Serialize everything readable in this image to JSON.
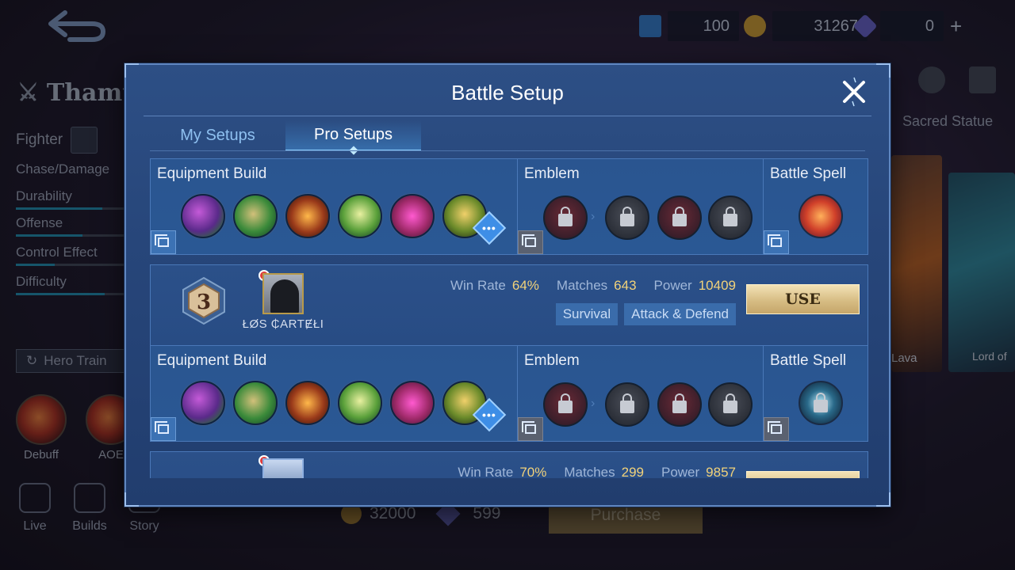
{
  "background": {
    "hero_name": "Thamu",
    "role": "Fighter",
    "stats": [
      {
        "label": "Chase/Damage",
        "value": 0.0
      },
      {
        "label": "Durability",
        "value": 0.78
      },
      {
        "label": "Offense",
        "value": 0.6
      },
      {
        "label": "Control Effect",
        "value": 0.35
      },
      {
        "label": "Difficulty",
        "value": 0.8
      }
    ],
    "hero_train_label": "Hero Train",
    "skills": [
      {
        "label": "Debuff"
      },
      {
        "label": "AOE"
      }
    ],
    "nav": [
      {
        "label": "Live"
      },
      {
        "label": "Builds"
      },
      {
        "label": "Story"
      }
    ],
    "resources": {
      "tickets": "100",
      "gold": "31267",
      "diamonds": "0"
    },
    "price_gold": "32000",
    "price_diamonds": "599",
    "purchase_label": "Purchase",
    "right_tab": "Sacred Statue",
    "skin_labels": [
      "Lava",
      "Lord of"
    ]
  },
  "modal": {
    "title": "Battle Setup",
    "tabs": [
      "My Setups",
      "Pro Setups"
    ],
    "active_tab": "Pro Setups",
    "section_labels": {
      "equipment": "Equipment Build",
      "emblem": "Emblem",
      "spell": "Battle Spell"
    },
    "more_label": "•••",
    "use_label": "USE",
    "players": [
      {
        "rank": "3",
        "name": "ŁØS ₵ARTɆŁI",
        "win_rate_label": "Win Rate",
        "win_rate": "64%",
        "matches_label": "Matches",
        "matches": "643",
        "power_label": "Power",
        "power": "10409",
        "tags": [
          "Survival",
          "Attack & Defend"
        ]
      },
      {
        "win_rate_label": "Win Rate",
        "win_rate": "70%",
        "matches_label": "Matches",
        "matches": "299",
        "power_label": "Power",
        "power": "9857"
      }
    ],
    "colors": {
      "accent": "#8fd0ff",
      "stat_value": "#f1d27a",
      "use_button": "#d7bd84"
    }
  }
}
